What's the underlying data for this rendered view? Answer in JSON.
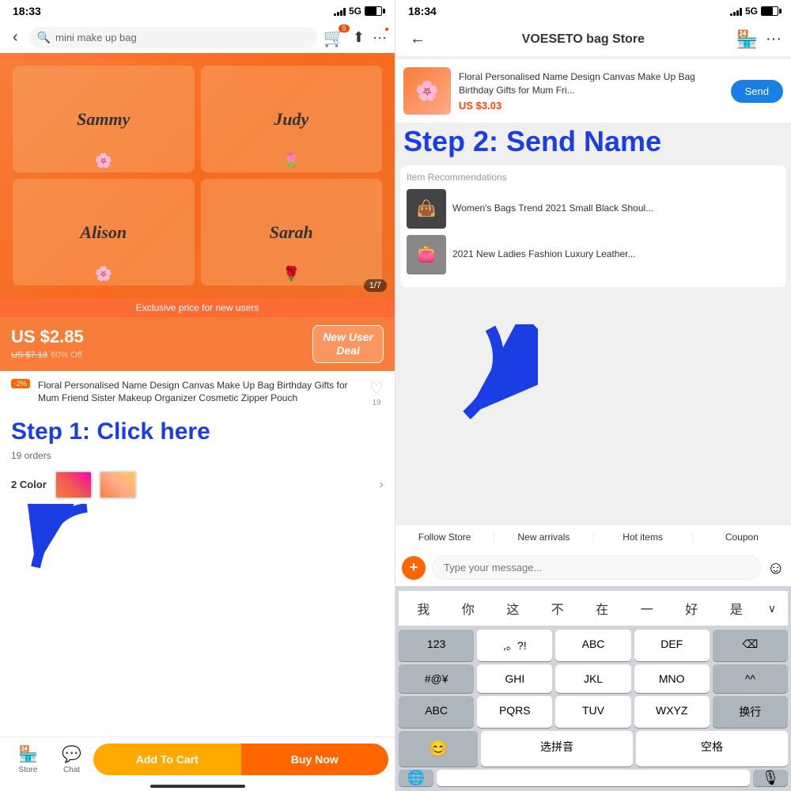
{
  "left": {
    "status_time": "18:33",
    "signal": "5G",
    "search_placeholder": "mini make up bag",
    "cart_count": "9",
    "image_counter": "1/7",
    "exclusive_bar": "Exclusive price for new users",
    "price": {
      "current": "US $2.85",
      "original": "US $7.13",
      "discount": "60% Off"
    },
    "new_user_deal": "New User\nDeal",
    "discount_pct": "-2%",
    "product_title": "Floral Personalised Name Design Canvas Make Up Bag Birthday Gifts for Mum Friend Sister Makeup Organizer Cosmetic Zipper Pouch",
    "wishlist_count": "19",
    "step1_label": "Step 1: Click here",
    "orders": "19 orders",
    "colors_label": "2 Color",
    "nav_store": "Store",
    "nav_chat": "Chat",
    "btn_add_to_cart": "Add To Cart",
    "btn_buy_now": "Buy Now",
    "bag_names": [
      "Sammy",
      "Judy",
      "Alison",
      "Sarah"
    ]
  },
  "right": {
    "status_time": "18:34",
    "signal": "5G",
    "store_name": "VOESETO bag Store",
    "product_card": {
      "title": "Floral Personalised Name Design Canvas Make Up Bag Birthday Gifts for Mum Fri...",
      "price": "US $3.03"
    },
    "send_btn": "Send",
    "step2_label": "Step 2: Send Name",
    "item_recommendations": "Item Recommendations",
    "rec_items": [
      {
        "title": "Women's Bags Trend 2021 Small Black Shoul...",
        "emoji": "👜"
      },
      {
        "title": "2021 New Ladies Fashion Luxury Leather...",
        "emoji": "👛"
      }
    ],
    "follow_bar": [
      "Follow Store",
      "New arrivals",
      "Hot items",
      "Coupon"
    ],
    "message_placeholder": "Type your message...",
    "keyboard": {
      "quick_chars": [
        "我",
        "你",
        "这",
        "不",
        "在",
        "一",
        "好",
        "是"
      ],
      "row1": [
        "123",
        ",。?!",
        "ABC",
        "DEF",
        "⌫"
      ],
      "row2": [
        "#@¥",
        "GHI",
        "JKL",
        "MNO",
        "^^"
      ],
      "row3": [
        "ABC",
        "PQRS",
        "TUV",
        "WXYZ",
        "换行"
      ],
      "row4_emoji": "😊",
      "row4_pinyin": "选拼音",
      "row4_space": "空格",
      "bottom_globe": "🌐",
      "bottom_mic": "🎙"
    }
  }
}
